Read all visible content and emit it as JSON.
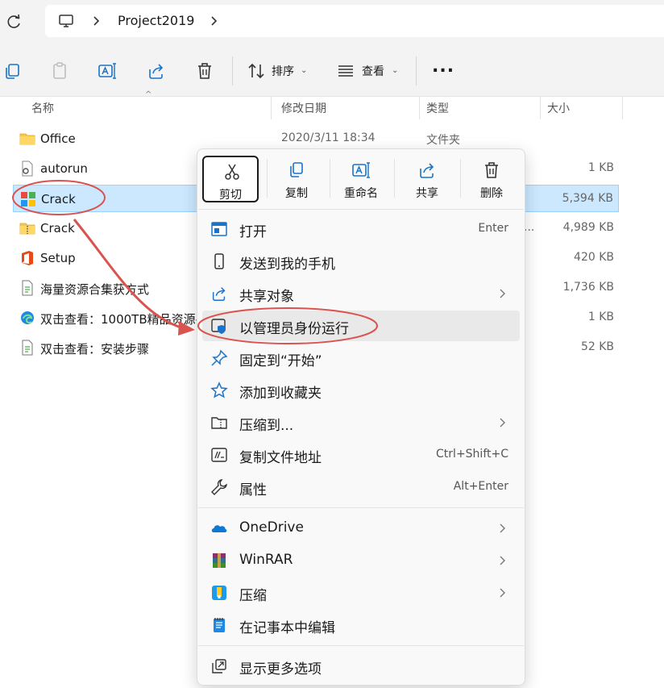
{
  "address_bar": {
    "path_segment": "Project2019",
    "refresh_icon": "refresh-icon",
    "pc_icon": "this-pc-icon"
  },
  "toolbar": {
    "icons": [
      "copy-icon",
      "paste-icon",
      "rename-icon",
      "share-icon",
      "delete-icon"
    ],
    "sort_label": "排序",
    "view_label": "查看",
    "more_label": "..."
  },
  "columns": {
    "name": "名称",
    "modified": "修改日期",
    "type": "类型",
    "size": "大小"
  },
  "files": [
    {
      "name": "Office",
      "date": "2020/3/11 18:34",
      "type": "文件夹",
      "size": "",
      "icon": "folder-icon"
    },
    {
      "name": "autorun",
      "date": "",
      "type": "",
      "size": "1 KB",
      "icon": "settings-file-icon"
    },
    {
      "name": "Crack",
      "date": "",
      "type": "",
      "size": "5,394 KB",
      "icon": "crack-app-icon",
      "selected": true
    },
    {
      "name": "Crack",
      "date": "",
      "type": "...",
      "size": "4,989 KB",
      "icon": "zip-folder-icon"
    },
    {
      "name": "Setup",
      "date": "",
      "type": "",
      "size": "420 KB",
      "icon": "office-icon"
    },
    {
      "name": "海量资源合集获方式",
      "date": "",
      "type": "",
      "size": "1,736 KB",
      "icon": "text-file-icon"
    },
    {
      "name": "双击查看：1000TB精品资源-",
      "date": "",
      "type": "",
      "size": "1 KB",
      "icon": "edge-link-icon"
    },
    {
      "name": "双击查看：安装步骤",
      "date": "",
      "type": "",
      "size": "52 KB",
      "icon": "text-file-icon"
    }
  ],
  "context_menu": {
    "quick_actions": [
      {
        "label": "剪切",
        "icon": "scissors-icon"
      },
      {
        "label": "复制",
        "icon": "copy-icon"
      },
      {
        "label": "重命名",
        "icon": "rename-icon"
      },
      {
        "label": "共享",
        "icon": "share-icon"
      },
      {
        "label": "删除",
        "icon": "trash-icon"
      }
    ],
    "items": [
      {
        "label": "打开",
        "shortcut": "Enter",
        "icon": "open-window-icon"
      },
      {
        "label": "发送到我的手机",
        "icon": "phone-icon"
      },
      {
        "label": "共享对象",
        "icon": "share-icon",
        "submenu": true
      },
      {
        "label": "以管理员身份运行",
        "icon": "admin-shield-icon"
      },
      {
        "label": "固定到“开始”",
        "icon": "pin-icon"
      },
      {
        "label": "添加到收藏夹",
        "icon": "star-icon"
      },
      {
        "label": "压缩到...",
        "icon": "zip-icon",
        "submenu": true
      },
      {
        "label": "复制文件地址",
        "shortcut": "Ctrl+Shift+C",
        "icon": "copy-path-icon"
      },
      {
        "label": "属性",
        "shortcut": "Alt+Enter",
        "icon": "wrench-icon"
      },
      {
        "label": "OneDrive",
        "icon": "onedrive-icon",
        "submenu": true
      },
      {
        "label": "WinRAR",
        "icon": "winrar-icon",
        "submenu": true
      },
      {
        "label": "压缩",
        "icon": "compress-app-icon",
        "submenu": true
      },
      {
        "label": "在记事本中编辑",
        "icon": "notepad-icon"
      },
      {
        "label": "显示更多选项",
        "icon": "more-options-icon"
      }
    ]
  },
  "colors": {
    "selection_bg": "#cce8ff",
    "annotation_red": "#d9534f",
    "accent_blue": "#1a73c8"
  }
}
